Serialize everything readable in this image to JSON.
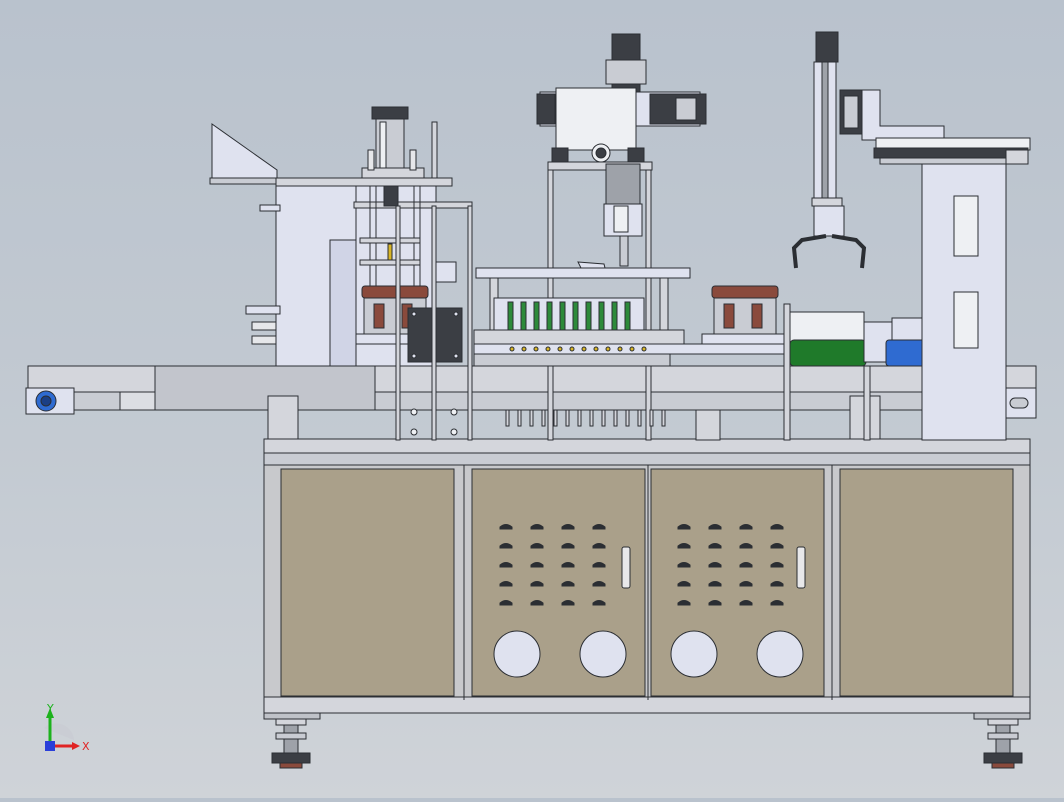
{
  "viewport": {
    "background_top": "#b9c2cd",
    "background_bottom": "#cfd3d8",
    "line_color": "#2b2e33"
  },
  "colors": {
    "frame_light": "#d4d6dc",
    "frame_mid": "#c9ccd3",
    "machine_blue": "#dfe2ef",
    "cabinet_panel": "#aaa08a",
    "cabinet_frame": "#c8c9cc",
    "motor_blue": "#2f6bd1",
    "roller_green": "#1f7a2a",
    "tray_brown": "#8a4a3c",
    "cylinder_dark": "#3b3e44",
    "slot_green": "#2d8a3a",
    "yellow_accent": "#d8b526"
  },
  "triad": {
    "x_label": "X",
    "y_label": "Y",
    "x_color": "#e02424",
    "y_color": "#1db21d",
    "z_color": "#2a3fd9"
  },
  "cabinet": {
    "vent_rows": 5,
    "vent_cols": 4,
    "doors": 4
  }
}
